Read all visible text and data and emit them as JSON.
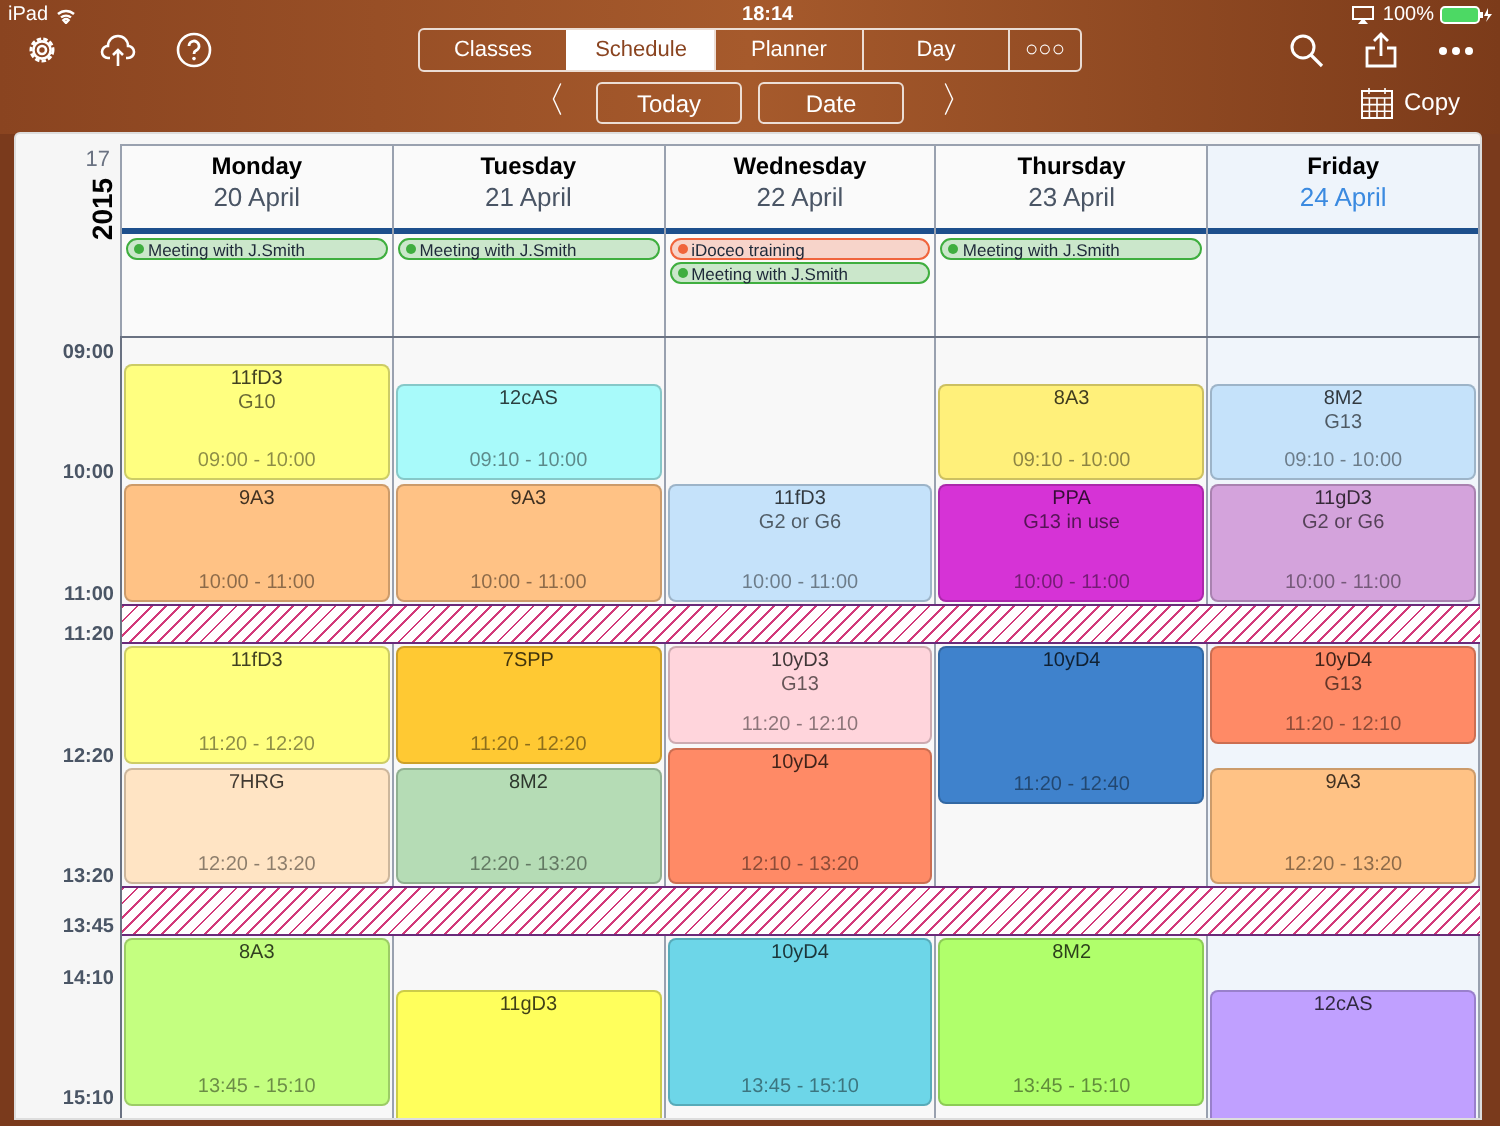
{
  "status_bar": {
    "device": "iPad",
    "time": "18:14",
    "battery": "100%"
  },
  "tabs": [
    {
      "label": "Classes",
      "selected": false
    },
    {
      "label": "Schedule",
      "selected": true
    },
    {
      "label": "Planner",
      "selected": false
    },
    {
      "label": "Day",
      "selected": false
    },
    {
      "label": "○○○",
      "selected": false
    }
  ],
  "nav": {
    "prev": "〈",
    "today": "Today",
    "date": "Date",
    "next": "〉",
    "copy": "Copy"
  },
  "week": {
    "number": "17",
    "year": "2015"
  },
  "time_labels": [
    "09:00",
    "10:00",
    "11:00",
    "11:20",
    "12:20",
    "13:20",
    "13:45",
    "14:10",
    "15:10"
  ],
  "days": [
    {
      "name": "Monday",
      "date": "20 April",
      "today": false,
      "all_day": [
        {
          "label": "Meeting with J.Smith",
          "color": "#3fae3f"
        }
      ],
      "lessons": [
        {
          "title": "11fD3",
          "room": "G10",
          "time": "09:00 - 10:00",
          "color": "#ffff80"
        },
        {
          "title": "9A3",
          "time": "10:00 - 11:00",
          "color": "#ffc285"
        },
        {
          "title": "11fD3",
          "time": "11:20 - 12:20",
          "color": "#ffff80"
        },
        {
          "title": "7HRG",
          "time": "12:20 - 13:20",
          "color": "#ffe4c4"
        },
        {
          "title": "8A3",
          "time": "13:45 - 15:10",
          "color": "#c4ff80"
        }
      ]
    },
    {
      "name": "Tuesday",
      "date": "21 April",
      "today": false,
      "all_day": [
        {
          "label": "Meeting with J.Smith",
          "color": "#3fae3f"
        }
      ],
      "lessons": [
        {
          "title": "12cAS",
          "time": "09:10 - 10:00",
          "color": "#a8fafa"
        },
        {
          "title": "9A3",
          "time": "10:00 - 11:00",
          "color": "#ffc285"
        },
        {
          "title": "7SPP",
          "time": "11:20 - 12:20",
          "color": "#ffc933"
        },
        {
          "title": "8M2",
          "time": "12:20 - 13:20",
          "color": "#b5dcb5"
        },
        {
          "title": "11gD3",
          "color": "#ffff5c"
        }
      ]
    },
    {
      "name": "Wednesday",
      "date": "22 April",
      "today": false,
      "all_day": [
        {
          "label": "iDoceo training",
          "color": "#f0643c"
        },
        {
          "label": "Meeting with J.Smith",
          "color": "#3fae3f"
        }
      ],
      "lessons": [
        {
          "title": "11fD3",
          "room": "G2 or G6",
          "time": "10:00 - 11:00",
          "color": "#c5e2fa"
        },
        {
          "title": "10yD3",
          "room": "G13",
          "time": "11:20 - 12:10",
          "color": "#ffd5dc"
        },
        {
          "title": "10yD4",
          "time": "12:10 - 13:20",
          "color": "#ff8a66"
        },
        {
          "title": "10yD4",
          "time": "13:45 - 15:10",
          "color": "#6dd6e8"
        }
      ]
    },
    {
      "name": "Thursday",
      "date": "23 April",
      "today": false,
      "all_day": [
        {
          "label": "Meeting with J.Smith",
          "color": "#3fae3f"
        }
      ],
      "lessons": [
        {
          "title": "8A3",
          "time": "09:10 - 10:00",
          "color": "#fff07a"
        },
        {
          "title": "PPA",
          "room": "G13 in use",
          "time": "10:00 - 11:00",
          "color": "#d633d6"
        },
        {
          "title": "10yD4",
          "time": "11:20 - 12:40",
          "color": "#3f82cc"
        },
        {
          "title": "8M2",
          "time": "13:45 - 15:10",
          "color": "#b0ff6b"
        }
      ]
    },
    {
      "name": "Friday",
      "date": "24 April",
      "today": true,
      "lessons": [
        {
          "title": "8M2",
          "room": "G13",
          "time": "09:10 - 10:00",
          "color": "#c5e2fa"
        },
        {
          "title": "11gD3",
          "room": "G2 or G6",
          "time": "10:00 - 11:00",
          "color": "#d4a3dc"
        },
        {
          "title": "10yD4",
          "room": "G13",
          "time": "11:20 - 12:10",
          "color": "#ff8a66"
        },
        {
          "title": "9A3",
          "time": "12:20 - 13:20",
          "color": "#ffc285"
        },
        {
          "title": "12cAS",
          "color": "#c0a0ff"
        }
      ]
    }
  ]
}
